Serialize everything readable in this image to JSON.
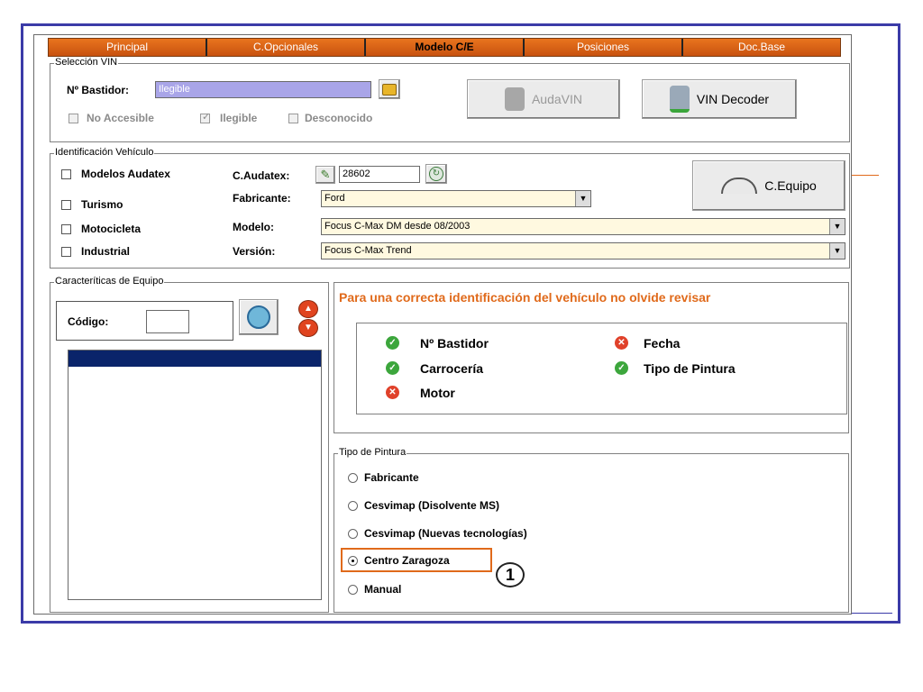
{
  "tabs": [
    {
      "label": "Principal"
    },
    {
      "label": "C.Opcionales"
    },
    {
      "label": "Modelo C/E"
    },
    {
      "label": "Posiciones"
    },
    {
      "label": "Doc.Base"
    }
  ],
  "vin_section": {
    "legend": "Selección VIN",
    "bastidor_label": "Nº Bastidor:",
    "bastidor_value": "Ilegible",
    "no_accesible": "No Accesible",
    "ilegible": "Ilegible",
    "desconocido": "Desconocido",
    "audavin_label": "AudaVIN",
    "vin_decoder_label": "VIN Decoder"
  },
  "ident_section": {
    "legend": "Identificación Vehículo",
    "checks": [
      "Modelos Audatex",
      "Turismo",
      "Motocicleta",
      "Industrial"
    ],
    "caudatex_label": "C.Audatex:",
    "caudatex_value": "28602",
    "fabricante_label": "Fabricante:",
    "fabricante_value": "Ford",
    "modelo_label": "Modelo:",
    "modelo_value": "Focus C-Max DM desde 08/2003",
    "version_label": "Versión:",
    "version_value": "Focus C-Max Trend",
    "cequipo_label": "C.Equipo"
  },
  "equipo_section": {
    "legend": "Caracteríticas de Equipo",
    "codigo_label": "Código:"
  },
  "review": {
    "title": "Para una correcta identificación del vehículo no olvide revisar",
    "items": [
      {
        "label": "Nº Bastidor",
        "status": "ok"
      },
      {
        "label": "Fecha",
        "status": "error"
      },
      {
        "label": "Carrocería",
        "status": "ok"
      },
      {
        "label": "Tipo de Pintura",
        "status": "ok"
      },
      {
        "label": "Motor",
        "status": "error"
      }
    ]
  },
  "pintura": {
    "legend": "Tipo de Pintura",
    "options": [
      "Fabricante",
      "Cesvimap (Disolvente MS)",
      "Cesvimap (Nuevas tecnologías)",
      "Centro Zaragoza",
      "Manual"
    ],
    "selected": "Centro Zaragoza",
    "callout": "1"
  },
  "colors": {
    "tab_orange": "#d9601a",
    "frame_blue": "#3b3ba8",
    "highlight_orange": "#e06a1b",
    "list_selected": "#0a246a"
  }
}
